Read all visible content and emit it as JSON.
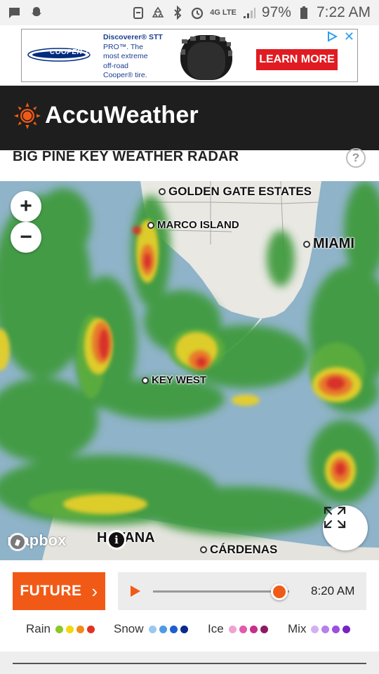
{
  "status_bar": {
    "battery_pct": "97%",
    "time": "7:22 AM",
    "network": "4G LTE",
    "icons": [
      "message-icon",
      "snapchat-icon",
      "sync-icon",
      "recycle-icon",
      "bluetooth-icon",
      "alarm-icon",
      "network-4g-icon",
      "signal-icon",
      "battery-icon"
    ]
  },
  "ad": {
    "brand": "COOPER TIRES",
    "line1": "Discoverer® STT",
    "line2": "PRO™. The",
    "line3": "most extreme",
    "line4": "off-road",
    "line5": "Cooper® tire.",
    "cta": "LEARN MORE",
    "close": "✕",
    "colors": {
      "cta": "#e11b22",
      "copy": "#1b3d8f",
      "adchoices": "#2b9df0"
    }
  },
  "header": {
    "brand": "AccuWeather",
    "colors": {
      "background": "#1e1e1e",
      "sun": "#f15a16"
    }
  },
  "page": {
    "title": "BIG PINE KEY WEATHER RADAR",
    "help": "?"
  },
  "map": {
    "zoom_in": "+",
    "zoom_out": "−",
    "attribution": "mapbox",
    "info": "i",
    "cities": {
      "golden_gate": "GOLDEN GATE ESTATES",
      "marco": "MARCO ISLAND",
      "miami": "MIAMI",
      "key_west": "KEY WEST",
      "havana": "HAVANA",
      "cardenas": "CÁRDENAS"
    },
    "colors": {
      "water": "#8fb3c8",
      "land": "#e8e7e2",
      "rain_light": "#3c9a3a",
      "rain_heavy": "#d8312a"
    }
  },
  "controls": {
    "future": "FUTURE",
    "future_chevron": "›",
    "time": "8:20 AM",
    "progress": 0.93,
    "accent": "#f15a16"
  },
  "legend": [
    {
      "name": "Rain",
      "colors": [
        "#8ac926",
        "#f2d80f",
        "#f28c18",
        "#e2331e"
      ]
    },
    {
      "name": "Snow",
      "colors": [
        "#9cc7f0",
        "#4d9be6",
        "#1d5fd0",
        "#0b2a8a"
      ]
    },
    {
      "name": "Ice",
      "colors": [
        "#f0a3cf",
        "#e25aae",
        "#c62e8e",
        "#8e1a64"
      ]
    },
    {
      "name": "Mix",
      "colors": [
        "#d4b0f2",
        "#b780ea",
        "#9a4fe0",
        "#7524c6"
      ]
    }
  ]
}
